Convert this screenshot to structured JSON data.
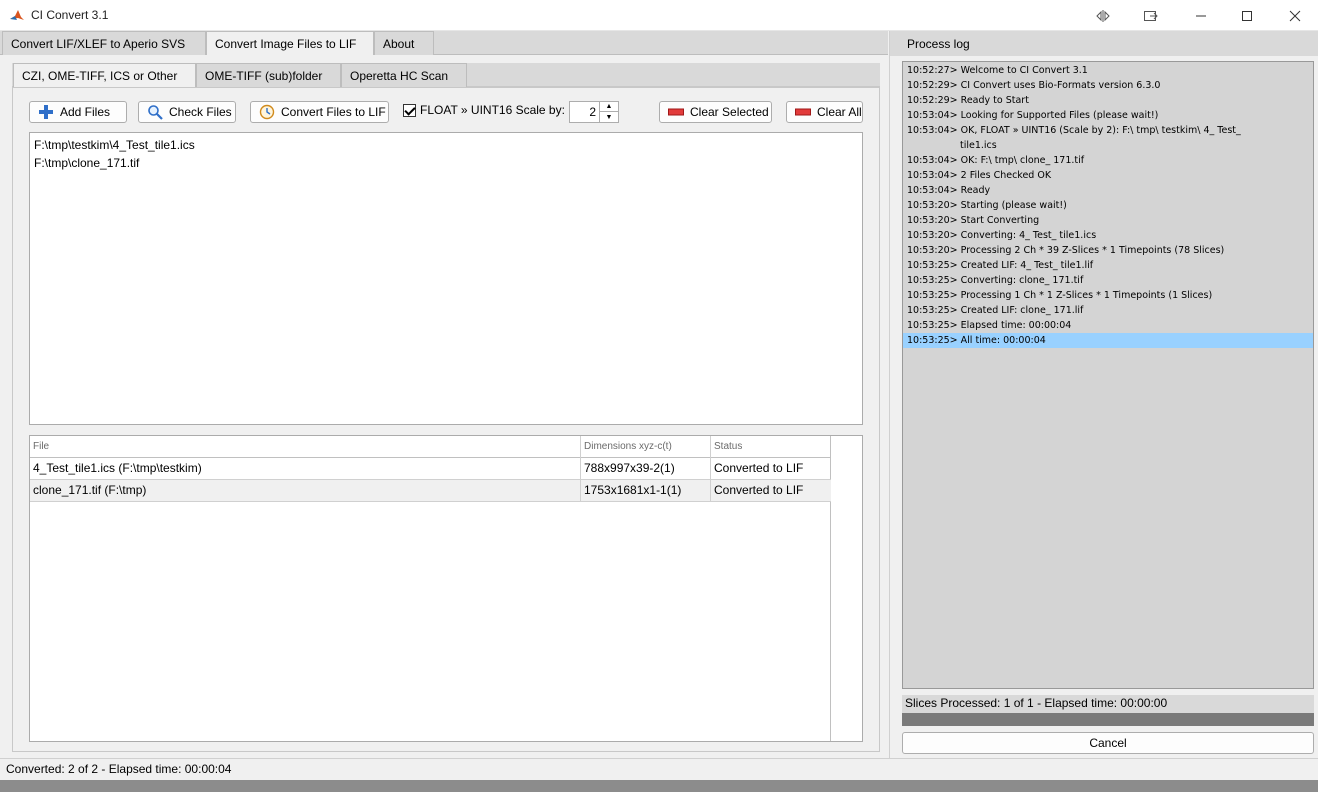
{
  "window": {
    "title": "CI Convert 3.1",
    "accent": "#c0392b"
  },
  "main_tabs": [
    {
      "label": "Convert LIF/XLEF to Aperio SVS",
      "active": false
    },
    {
      "label": "Convert Image Files to LIF",
      "active": true
    },
    {
      "label": "About",
      "active": false
    }
  ],
  "sub_tabs": [
    {
      "label": "CZI, OME-TIFF, ICS or Other",
      "active": true
    },
    {
      "label": "OME-TIFF (sub)folder",
      "active": false
    },
    {
      "label": "Operetta HC Scan",
      "active": false
    }
  ],
  "toolbar": {
    "add_files": "Add Files",
    "check_files": "Check Files",
    "convert_files": "Convert Files to LIF",
    "float_label": "FLOAT » UINT16 Scale by:",
    "float_checked": true,
    "scale_value": "2",
    "clear_selected": "Clear Selected",
    "clear_all": "Clear All"
  },
  "file_list": [
    "F:\\tmp\\testkim\\4_Test_tile1.ics",
    "F:\\tmp\\clone_171.tif"
  ],
  "table": {
    "headers": [
      "File",
      "Dimensions xyz-c(t)",
      "Status"
    ],
    "rows": [
      {
        "file": "4_Test_tile1.ics (F:\\tmp\\testkim)",
        "dims": "788x997x39-2(1)",
        "status": "Converted to LIF"
      },
      {
        "file": "clone_171.tif (F:\\tmp)",
        "dims": "1753x1681x1-1(1)",
        "status": "Converted to LIF"
      }
    ]
  },
  "status_bar": "Converted: 2 of 2 - Elapsed time: 00:00:04",
  "process_log": {
    "title": "Process log",
    "lines": [
      {
        "text": "10:52:27> Welcome to CI Convert 3.1",
        "cont": false,
        "highlight": false
      },
      {
        "text": "10:52:29> CI Convert uses Bio-Formats version 6.3.0",
        "cont": false,
        "highlight": false
      },
      {
        "text": "10:52:29> Ready to Start",
        "cont": false,
        "highlight": false
      },
      {
        "text": "10:53:04> Looking for Supported Files (please wait!)",
        "cont": false,
        "highlight": false
      },
      {
        "text": "10:53:04> OK, FLOAT » UINT16 (Scale by 2): F:\\ tmp\\ testkim\\ 4_ Test_",
        "cont": false,
        "highlight": false
      },
      {
        "text": "tile1.ics",
        "cont": true,
        "highlight": false
      },
      {
        "text": "10:53:04> OK: F:\\ tmp\\ clone_ 171.tif",
        "cont": false,
        "highlight": false
      },
      {
        "text": "10:53:04> 2 Files Checked OK",
        "cont": false,
        "highlight": false
      },
      {
        "text": "10:53:04> Ready",
        "cont": false,
        "highlight": false
      },
      {
        "text": "10:53:20> Starting (please wait!)",
        "cont": false,
        "highlight": false
      },
      {
        "text": "10:53:20> Start Converting",
        "cont": false,
        "highlight": false
      },
      {
        "text": "10:53:20> Converting: 4_ Test_ tile1.ics",
        "cont": false,
        "highlight": false
      },
      {
        "text": "10:53:20> Processing 2 Ch * 39 Z-Slices * 1 Timepoints (78 Slices)",
        "cont": false,
        "highlight": false
      },
      {
        "text": "10:53:25> Created LIF: 4_ Test_ tile1.lif",
        "cont": false,
        "highlight": false
      },
      {
        "text": "10:53:25> Converting: clone_ 171.tif",
        "cont": false,
        "highlight": false
      },
      {
        "text": "10:53:25> Processing 1 Ch * 1 Z-Slices * 1 Timepoints (1 Slices)",
        "cont": false,
        "highlight": false
      },
      {
        "text": "10:53:25> Created LIF: clone_ 171.lif",
        "cont": false,
        "highlight": false
      },
      {
        "text": "10:53:25> Elapsed time: 00:00:04",
        "cont": false,
        "highlight": false
      },
      {
        "text": "10:53:25> All time: 00:00:04",
        "cont": false,
        "highlight": true
      }
    ],
    "slices_processed": "Slices Processed: 1 of 1 - Elapsed time: 00:00:00",
    "progress_fraction": 1.0,
    "cancel": "Cancel"
  }
}
